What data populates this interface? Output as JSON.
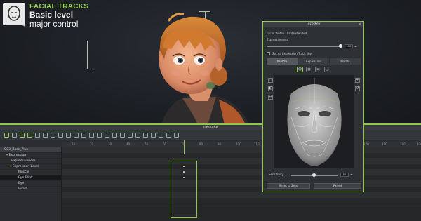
{
  "branding": {
    "title": "FACIAL TRACKS",
    "line1": "Basic level",
    "line2": "major control",
    "logo_badge": "4",
    "accent": "#8fc84b"
  },
  "timeline": {
    "title": "Timeline",
    "ruler": [
      "10",
      "20",
      "30",
      "40",
      "50",
      "60",
      "70",
      "80",
      "90",
      "100",
      "110",
      "120",
      "130",
      "140",
      "150",
      "160",
      "170",
      "180",
      "190",
      "200"
    ],
    "tree": [
      {
        "label": "CC3_Base_Plus",
        "style": "hl"
      },
      {
        "label": "Expression",
        "style": ""
      },
      {
        "label": "Expressiveness",
        "style": ""
      },
      {
        "label": "Expression Level",
        "style": ""
      },
      {
        "label": "Muscle",
        "style": ""
      },
      {
        "label": "Eye Blink",
        "style": "sel"
      },
      {
        "label": "Eye",
        "style": ""
      },
      {
        "label": "Head",
        "style": ""
      }
    ]
  },
  "face_key": {
    "title": "Face Key",
    "profile_label": "Facial Profile : CC4 Extended",
    "expressiveness_label": "Expressiveness",
    "expressiveness_value": "100",
    "track_key_label": "Set All Expression Track Key",
    "tabs": [
      "Muscle",
      "Expression",
      "Modify"
    ],
    "active_tab": 0,
    "sensitivity_label": "Sensitivity",
    "sensitivity_value": "50",
    "reset_label": "Reset to Zero",
    "paired_label": "Paired"
  }
}
